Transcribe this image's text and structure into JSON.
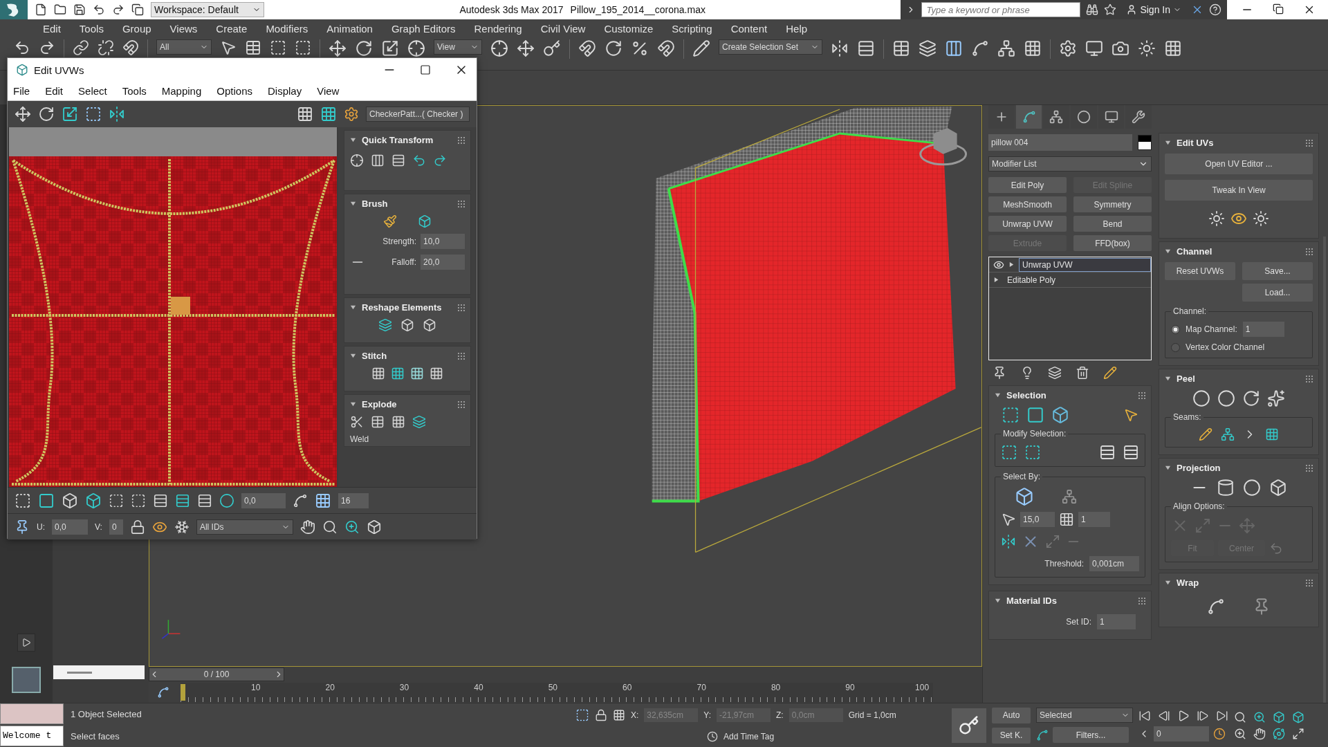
{
  "title_bar": {
    "workspace": "Workspace: Default",
    "app": "Autodesk 3ds Max 2017",
    "file": "Pillow_195_2014__corona.max",
    "search_placeholder": "Type a keyword or phrase",
    "sign_in": "Sign In"
  },
  "menu": [
    "Edit",
    "Tools",
    "Group",
    "Views",
    "Create",
    "Modifiers",
    "Animation",
    "Graph Editors",
    "Rendering",
    "Civil View",
    "Customize",
    "Scripting",
    "Content",
    "Help"
  ],
  "main_toolbar": {
    "filter": "All",
    "reference": "View",
    "selection_set": "Create Selection Set"
  },
  "uv_editor": {
    "title": "Edit UVWs",
    "menu": [
      "File",
      "Edit",
      "Select",
      "Tools",
      "Mapping",
      "Options",
      "Display",
      "View"
    ],
    "texture": "CheckerPatt...( Checker )",
    "rollouts": [
      {
        "kind": "quick_transform",
        "title": "Quick Transform",
        "expanded": true
      },
      {
        "kind": "brush",
        "title": "Brush",
        "expanded": true,
        "strength_label": "Strength:",
        "strength": "10,0",
        "falloff_label": "Falloff:",
        "falloff": "20,0"
      },
      {
        "kind": "reshape",
        "title": "Reshape Elements",
        "expanded": true
      },
      {
        "kind": "stitch",
        "title": "Stitch",
        "expanded": true
      },
      {
        "kind": "explode",
        "title": "Explode",
        "expanded": true,
        "caption": "Weld"
      }
    ],
    "soft_value": "0,0",
    "grid_value": "16",
    "u_label": "U:",
    "u": "0,0",
    "v_label": "V:",
    "v": "0",
    "ids": "All IDs"
  },
  "command_panel": {
    "tabs": [
      {
        "selected": false
      },
      {
        "selected": true
      },
      {
        "selected": false
      },
      {
        "selected": false
      },
      {
        "selected": false
      },
      {
        "selected": false
      }
    ],
    "object_name": "pillow 004",
    "modifier_list": "Modifier List",
    "modifier_buttons": [
      {
        "label": "Edit Poly",
        "disabled": false
      },
      {
        "label": "Edit Spline",
        "disabled": true
      },
      {
        "label": "MeshSmooth",
        "disabled": false
      },
      {
        "label": "Symmetry",
        "disabled": false
      },
      {
        "label": "Unwrap UVW",
        "disabled": false
      },
      {
        "label": "Bend",
        "disabled": false
      },
      {
        "label": "Extrude",
        "disabled": true
      },
      {
        "label": "FFD(box)",
        "disabled": false
      }
    ],
    "stack": [
      {
        "label": "Unwrap UVW",
        "selected": true,
        "eye": true
      },
      {
        "label": "Editable Poly",
        "selected": false,
        "eye": false
      }
    ],
    "selection": {
      "title": "Selection",
      "modify_label": "Modify Selection:",
      "select_by_label": "Select By:",
      "angle": "15,0",
      "planar": "1",
      "threshold_label": "Threshold:",
      "threshold": "0,001cm"
    },
    "material_ids": {
      "title": "Material IDs",
      "set_id_label": "Set ID:",
      "set_id": "1"
    },
    "edit_uvs": {
      "title": "Edit UVs",
      "open": "Open UV Editor ...",
      "tweak": "Tweak In View"
    },
    "channel": {
      "title": "Channel",
      "reset": "Reset UVWs",
      "save": "Save...",
      "load": "Load...",
      "group": "Channel:",
      "options": [
        {
          "label": "Map Channel:",
          "selected": true,
          "value": "1"
        },
        {
          "label": "Vertex Color Channel",
          "selected": false
        }
      ]
    },
    "peel": {
      "title": "Peel",
      "seams": "Seams:"
    },
    "projection": {
      "title": "Projection",
      "align": "Align Options:",
      "fit": "Fit",
      "center": "Center"
    },
    "wrap": {
      "title": "Wrap"
    }
  },
  "timeline": {
    "frame": "0 / 100",
    "level": 0,
    "ticks": [
      "10",
      "20",
      "30",
      "40",
      "50",
      "60",
      "70",
      "80",
      "90",
      "100"
    ]
  },
  "status_bar": {
    "listener": "Welcome t",
    "selection": "1 Object Selected",
    "prompt": "Select faces",
    "x_label": "X:",
    "x": "32,635cm",
    "y_label": "Y:",
    "y": "-21,97cm",
    "z_label": "Z:",
    "z": "0,0cm",
    "grid": "Grid = 1,0cm",
    "time_tag": "Add Time Tag"
  },
  "animation": {
    "auto": "Auto",
    "key_mode": "Selected",
    "set_key": "Set K.",
    "filters": "Filters...",
    "frame": "0"
  }
}
